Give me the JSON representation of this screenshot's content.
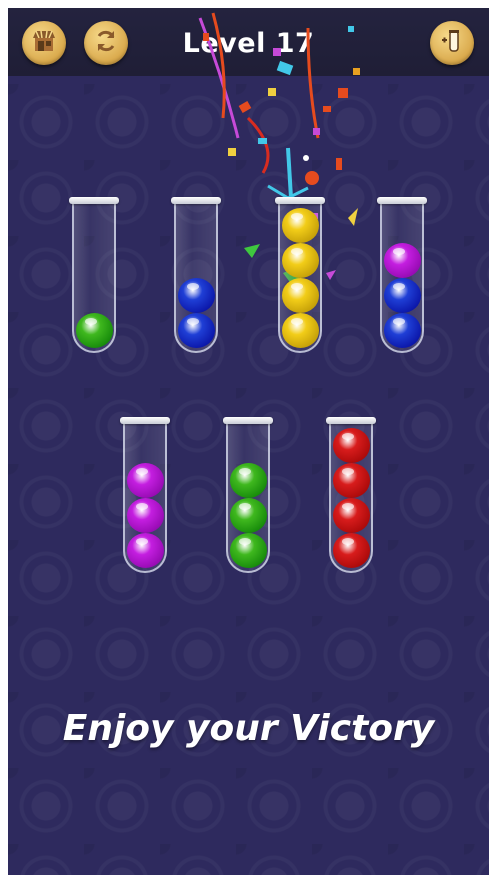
{
  "header": {
    "level_title": "Level 17",
    "left_buttons": [
      {
        "icon": "shop-icon"
      },
      {
        "icon": "restart-icon"
      }
    ],
    "right_button": {
      "icon": "add-tube-icon"
    }
  },
  "colors": {
    "green": "#3fb81e",
    "blue": "#1f3fd6",
    "yellow": "#f2cd18",
    "purple": "#c41ee0",
    "red": "#d81c1c"
  },
  "tubes": [
    {
      "balls": [
        "green"
      ]
    },
    {
      "balls": [
        "blue",
        "blue"
      ]
    },
    {
      "balls": [
        "yellow",
        "yellow",
        "yellow",
        "yellow"
      ]
    },
    {
      "balls": [
        "blue",
        "blue",
        "purple"
      ]
    },
    {
      "balls": [
        "purple",
        "purple",
        "purple"
      ]
    },
    {
      "balls": [
        "green",
        "green",
        "green"
      ]
    },
    {
      "balls": [
        "red",
        "red",
        "red",
        "red"
      ]
    }
  ],
  "message": "Enjoy your Victory"
}
